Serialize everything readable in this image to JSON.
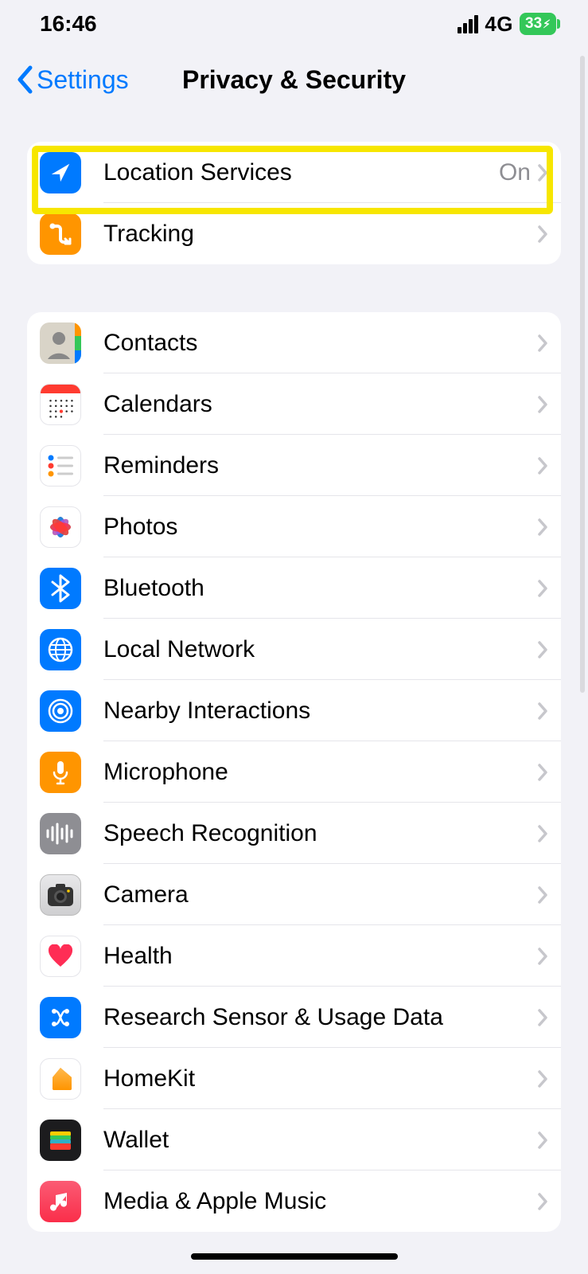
{
  "status": {
    "time": "16:46",
    "network": "4G",
    "battery_pct": "33"
  },
  "nav": {
    "back_label": "Settings",
    "title": "Privacy & Security"
  },
  "group1": {
    "items": [
      {
        "label": "Location Services",
        "value": "On",
        "icon": "location"
      },
      {
        "label": "Tracking",
        "value": "",
        "icon": "tracking"
      }
    ]
  },
  "group2": {
    "items": [
      {
        "label": "Contacts",
        "icon": "contacts"
      },
      {
        "label": "Calendars",
        "icon": "calendar"
      },
      {
        "label": "Reminders",
        "icon": "reminders"
      },
      {
        "label": "Photos",
        "icon": "photos"
      },
      {
        "label": "Bluetooth",
        "icon": "bluetooth"
      },
      {
        "label": "Local Network",
        "icon": "localnetwork"
      },
      {
        "label": "Nearby Interactions",
        "icon": "nearby"
      },
      {
        "label": "Microphone",
        "icon": "microphone"
      },
      {
        "label": "Speech Recognition",
        "icon": "speech"
      },
      {
        "label": "Camera",
        "icon": "camera"
      },
      {
        "label": "Health",
        "icon": "health"
      },
      {
        "label": "Research Sensor & Usage Data",
        "icon": "research"
      },
      {
        "label": "HomeKit",
        "icon": "homekit"
      },
      {
        "label": "Wallet",
        "icon": "wallet"
      },
      {
        "label": "Media & Apple Music",
        "icon": "music"
      }
    ]
  }
}
